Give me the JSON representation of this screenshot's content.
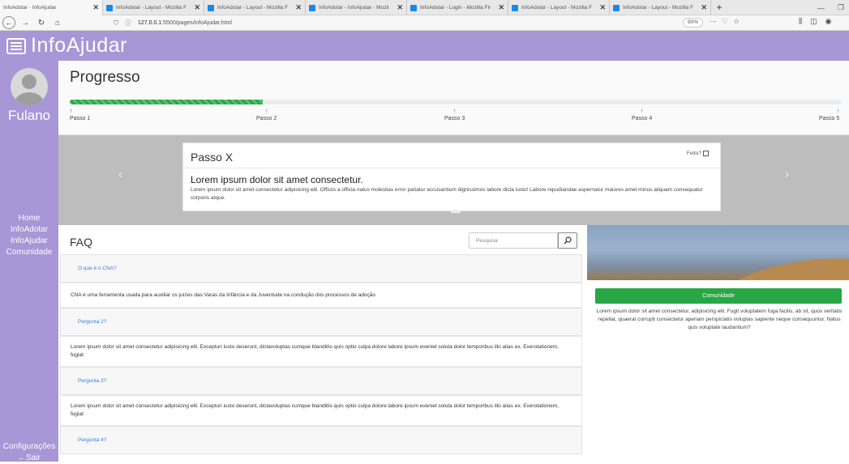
{
  "browser": {
    "tabs": [
      {
        "title": "InfoAdotar - InfoAjudar",
        "active": true
      },
      {
        "title": "InfoAdotar - Layout - Mozilla F"
      },
      {
        "title": "InfoAdotar - Layout - Mozilla F"
      },
      {
        "title": "InfoAdotar - InfoAjudar - Mozil"
      },
      {
        "title": "InfoAdotar - Login - Mozilla Fir"
      },
      {
        "title": "InfoAdotar - Layout - Mozilla F"
      },
      {
        "title": "InfoAdotar - Layout - Mozilla F"
      }
    ],
    "url_host": "127.0.0.1",
    "url_rest": ":5500/pages/infoAjudar.html",
    "zoom": "90%"
  },
  "app": {
    "brand": "InfoAjudar",
    "user_name": "Fulano",
    "menu": [
      "Home",
      "InfoAdotar",
      "InfoAjudar",
      "Comunidade"
    ],
    "settings_label": "Configurações",
    "logout_label": "←Sair"
  },
  "progress": {
    "title": "Progresso",
    "value": 0.25,
    "steps": [
      {
        "arrow": "↑",
        "label": "Passo 1"
      },
      {
        "arrow": "↑",
        "label": "Passo 2"
      },
      {
        "arrow": "↑",
        "label": "Passo 3"
      },
      {
        "arrow": "↑",
        "label": "Passo 4"
      },
      {
        "arrow": "↑",
        "label": "Passo 5"
      }
    ]
  },
  "carousel": {
    "prev": "‹",
    "next": "›",
    "card_title": "Passo X",
    "done_label": "Feito?",
    "lead": "Lorem ipsum dolor sit amet consectetur.",
    "text": "Lorem ipsum dolor sit amet consectetur adipisicing elit. Officiis a officia natus molestias error pariatur accusantium dignissimos labore dicta iusto! Labore repudiandae aspernatur maiores amet minus aliquam consequatur corporis atque."
  },
  "faq": {
    "title": "FAQ",
    "search_placeholder": "Pesquisa",
    "items": [
      {
        "question": "O que é o CNA?",
        "answer": "CNA é uma ferramenta usada para auxiliar os juízes das Varas da Infância e da Juventude na condução dos processos de adoção"
      },
      {
        "question": "Pergunta 2?",
        "answer": "Lorem ipsum dolor sit amet consectetur adipisicing elit. Excepturi iusto deserunt, dictavoluptas cumque blanditiis quis optio culpa dolore labore ipsum eveniet soluta dolor temporibus illo alias ex. Exerotationem, fugiat"
      },
      {
        "question": "Pergunta 3?",
        "answer": "Lorem ipsum dolor sit amet consectetur adipisicing elit. Excepturi iusto deserunt, dictavoluptas cumque blanditiis quis optio culpa dolore labore ipsum eveniet soluta dolor temporibus illo alias ex. Exerotationem, fugiat"
      },
      {
        "question": "Pergunta 4?"
      }
    ]
  },
  "community": {
    "button_label": "Comunidade",
    "button_color": "#28a745",
    "text": "Lorem ipsum dolor sit amet consectetur, adipisicing elit. Fugit voluptatem fuga facilis, ab sit, quos veritatis repellat, quaerat corrupti consectetur aperiam perspiciatis voluptas sapiente neque consequuntur. Natus quis voluptate laudantium?"
  },
  "colors": {
    "brand_purple": "#a896d6",
    "progress_green": "#28a745",
    "link_blue": "#3b7ddd"
  }
}
